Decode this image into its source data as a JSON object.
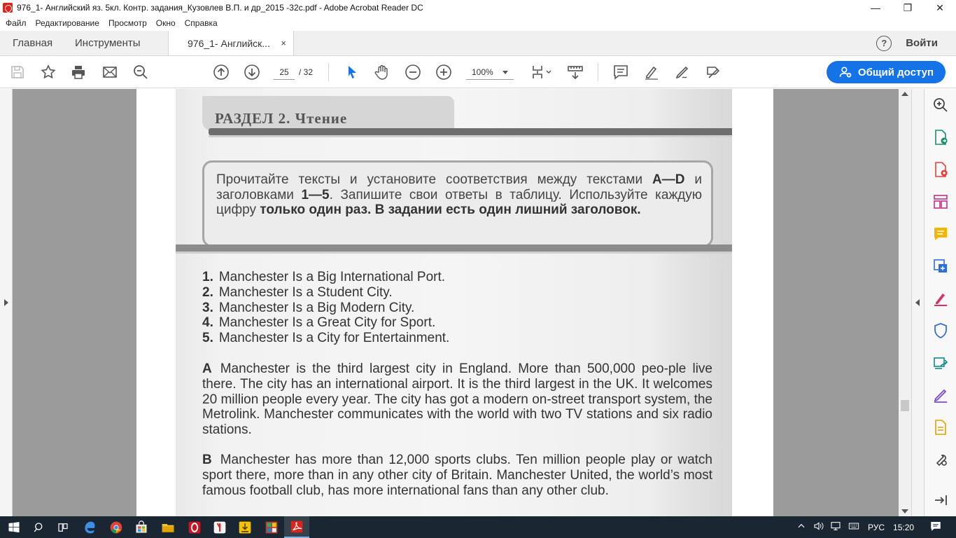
{
  "window": {
    "title": "976_1- Английский яз. 5кл. Контр. задания_Кузовлев В.П. и др_2015 -32с.pdf - Adobe Acrobat Reader DC",
    "minimize": "—",
    "restore": "❐",
    "close": "✕"
  },
  "menu": [
    "Файл",
    "Редактирование",
    "Просмотр",
    "Окно",
    "Справка"
  ],
  "tabs": {
    "home": "Главная",
    "tools": "Инструменты",
    "document": "976_1- Английск...",
    "close": "×",
    "help": "?",
    "signin": "Войти"
  },
  "toolbar": {
    "page_current": "25",
    "page_total": "/ 32",
    "zoom": "100%",
    "share": "Общий доступ",
    "icons": [
      "save-icon",
      "bookmark-star-icon",
      "print-icon",
      "email-icon",
      "search-zoom-icon",
      "page-up-icon",
      "page-down-icon",
      "select-cursor-icon",
      "hand-icon",
      "zoom-out-icon",
      "zoom-in-icon",
      "page-fit-icon",
      "scroll-mode-icon",
      "comment-icon",
      "highlight-icon",
      "sign-icon",
      "more-tools-icon"
    ]
  },
  "document": {
    "section_title": "РАЗДЕЛ 2. Чтение",
    "instructions_plain1": "Прочитайте тексты и установите соответствия между текстами ",
    "instructions_bold1": "A—D",
    "instructions_plain2": " и заголовками ",
    "instructions_bold2": "1—5",
    "instructions_plain3": ". Запишите свои ответы в таблицу. Используйте каждую цифру ",
    "instructions_bold3": "только один раз. В задании есть один лишний заголовок.",
    "headings": [
      {
        "n": "1.",
        "text": "Manchester Is a Big International Port."
      },
      {
        "n": "2.",
        "text": "Manchester Is a Student City."
      },
      {
        "n": "3.",
        "text": "Manchester Is a Big Modern City."
      },
      {
        "n": "4.",
        "text": "Manchester Is a Great City for Sport."
      },
      {
        "n": "5.",
        "text": "Manchester Is a City for Entertainment."
      }
    ],
    "text_a_letter": "A",
    "text_a": "Manchester is the third largest city in England. More than 500,000 peo-ple live there. The city has an international airport. It is the third largest in the UK. It welcomes 20 million people every year. The city has got a modern on-street transport system, the Metrolink. Manchester communicates with the world with two TV stations and six radio stations.",
    "text_b_letter": "B",
    "text_b": "Manchester has more than 12,000 sports clubs. Ten million people play or watch sport there, more than in any other city of Britain. Manchester United, the world’s most famous football club, has more international fans than any other club."
  },
  "rightpane_icons": [
    "search-zoom-icon",
    "export-pdf-icon",
    "create-pdf-icon",
    "organize-pages-icon",
    "comment-icon",
    "edit-pdf-icon",
    "fill-sign-icon",
    "protect-icon",
    "send-track-icon",
    "more-sign-icon",
    "export-file-icon",
    "tools-icon",
    "expand-icon"
  ],
  "taskbar": {
    "lang": "РУС",
    "time": "15:20"
  },
  "colors": {
    "accent": "#1473e6",
    "taskbar": "#1a2733",
    "doc_bg": "#9b9b9b"
  }
}
